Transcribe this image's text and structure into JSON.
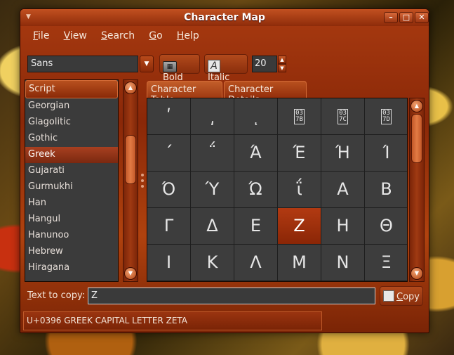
{
  "window": {
    "title": "Character Map"
  },
  "menu": [
    {
      "pre": "",
      "ul": "F",
      "post": "ile"
    },
    {
      "pre": "",
      "ul": "V",
      "post": "iew"
    },
    {
      "pre": "",
      "ul": "S",
      "post": "earch"
    },
    {
      "pre": "",
      "ul": "G",
      "post": "o"
    },
    {
      "pre": "",
      "ul": "H",
      "post": "elp"
    }
  ],
  "toolbar": {
    "font_value": "Sans",
    "bold_pre": "",
    "bold_ul": "B",
    "bold_post": "old",
    "italic_pre": "",
    "italic_ul": "I",
    "italic_post": "talic",
    "size_value": "20"
  },
  "script_list": {
    "header": "Script",
    "items": [
      "Georgian",
      "Glagolitic",
      "Gothic",
      "Greek",
      "Gujarati",
      "Gurmukhi",
      "Han",
      "Hangul",
      "Hanunoo",
      "Hebrew",
      "Hiragana"
    ],
    "selected": "Greek"
  },
  "tabs": {
    "table_pre": "Character ",
    "table_ul": "T",
    "table_post": "able",
    "details_pre": "Character ",
    "details_ul": "D",
    "details_post": "etails"
  },
  "grid": {
    "rows": [
      [
        "ʹ",
        "͵",
        "ͺ",
        "037B",
        "037C",
        "037D"
      ],
      [
        "΄",
        "΅",
        "Ά",
        "Έ",
        "Ή",
        "Ί"
      ],
      [
        "Ό",
        "Ύ",
        "Ώ",
        "ΐ",
        "Α",
        "Β"
      ],
      [
        "Γ",
        "Δ",
        "Ε",
        "Ζ",
        "Η",
        "Θ"
      ],
      [
        "Ι",
        "Κ",
        "Λ",
        "Μ",
        "Ν",
        "Ξ"
      ]
    ],
    "hex_placeholders": [
      "037B",
      "037C",
      "037D"
    ],
    "selected": "Ζ"
  },
  "copy": {
    "label_pre": "",
    "label_ul": "T",
    "label_post": "ext to copy:",
    "value": "Z",
    "button_pre": "",
    "button_ul": "C",
    "button_post": "opy"
  },
  "status": {
    "text": "U+0396 GREEK CAPITAL LETTER ZETA"
  }
}
